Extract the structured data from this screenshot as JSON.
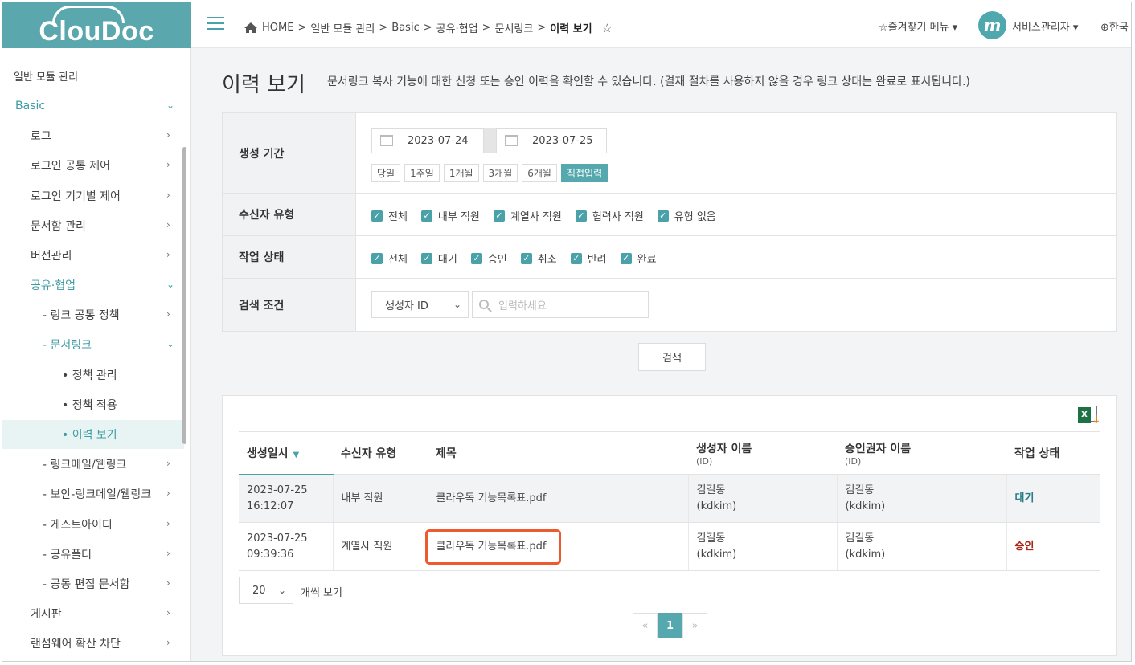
{
  "app": {
    "logo": "ClouDoc"
  },
  "sidebar": {
    "items": [
      {
        "label": "일반 모듈 관리",
        "arrow": ""
      },
      {
        "label": "Basic",
        "arrow": "⌄"
      },
      {
        "label": "로그",
        "arrow": "›"
      },
      {
        "label": "로그인 공통 제어",
        "arrow": "›"
      },
      {
        "label": "로그인 기기별 제어",
        "arrow": "›"
      },
      {
        "label": "문서함 관리",
        "arrow": "›"
      },
      {
        "label": "버전관리",
        "arrow": "›"
      },
      {
        "label": "공유·협업",
        "arrow": "⌄"
      },
      {
        "label": "- 링크 공통 정책",
        "arrow": "›"
      },
      {
        "label": "- 문서링크",
        "arrow": "⌄"
      },
      {
        "label": "• 정책 관리",
        "arrow": ""
      },
      {
        "label": "• 정책 적용",
        "arrow": ""
      },
      {
        "label": "• 이력 보기",
        "arrow": ""
      },
      {
        "label": "- 링크메일/웹링크",
        "arrow": "›"
      },
      {
        "label": "- 보안-링크메일/웹링크",
        "arrow": "›"
      },
      {
        "label": "- 게스트아이디",
        "arrow": "›"
      },
      {
        "label": "- 공유폴더",
        "arrow": "›"
      },
      {
        "label": "- 공동 편집 문서함",
        "arrow": "›"
      },
      {
        "label": "게시판",
        "arrow": "›"
      },
      {
        "label": "랜섬웨어 확산 차단",
        "arrow": "›"
      }
    ]
  },
  "topbar": {
    "breadcrumb": [
      "HOME",
      "일반 모듈 관리",
      "Basic",
      "공유·협업",
      "문서링크",
      "이력 보기"
    ],
    "favorites": "즐겨찾기 메뉴 ▾",
    "avatar_letter": "m",
    "user": "서비스관리자 ▾",
    "lang": "한국"
  },
  "page": {
    "title": "이력 보기",
    "description": "문서링크 복사 기능에 대한 신청 또는 승인 이력을 확인할 수 있습니다. (결재 절차를 사용하지 않을 경우 링크 상태는 완료로 표시됩니다.)"
  },
  "filter": {
    "period": {
      "label": "생성 기간",
      "start": "2023-07-24",
      "end": "2023-07-25",
      "dash": "-",
      "quick": [
        "당일",
        "1주일",
        "1개월",
        "3개월",
        "6개월",
        "직접입력"
      ]
    },
    "recipient": {
      "label": "수신자 유형",
      "options": [
        "전체",
        "내부 직원",
        "계열사 직원",
        "협력사 직원",
        "유형 없음"
      ]
    },
    "status": {
      "label": "작업 상태",
      "options": [
        "전체",
        "대기",
        "승인",
        "취소",
        "반려",
        "완료"
      ]
    },
    "condition": {
      "label": "검색 조건",
      "field": "생성자 ID",
      "placeholder": "입력하세요"
    },
    "search_button": "검색"
  },
  "table": {
    "headers": {
      "created": "생성일시",
      "recipient": "수신자 유형",
      "title": "제목",
      "creator": "생성자 이름",
      "creator_sub": "(ID)",
      "approver": "승인권자 이름",
      "approver_sub": "(ID)",
      "status": "작업 상태"
    },
    "rows": [
      {
        "date": "2023-07-25",
        "time": "16:12:07",
        "recipient": "내부 직원",
        "title": "클라우독 기능목록표.pdf",
        "creator": "김길동",
        "creator_id": "(kdkim)",
        "approver": "김길동",
        "approver_id": "(kdkim)",
        "status": "대기"
      },
      {
        "date": "2023-07-25",
        "time": "09:39:36",
        "recipient": "계열사 직원",
        "title": "클라우독 기능목록표.pdf",
        "creator": "김길동",
        "creator_id": "(kdkim)",
        "approver": "김길동",
        "approver_id": "(kdkim)",
        "status": "승인"
      }
    ],
    "per_page": "20",
    "per_page_label": "개씩 보기",
    "pager": {
      "prev": "«",
      "current": "1",
      "next": "»"
    },
    "excel_icon": "excel-download-icon"
  },
  "colors": {
    "brand": "#5aa8ae",
    "accent": "#4aa1a8",
    "wait": "#2a7d86",
    "approved": "#a6261a",
    "highlight": "#ec5a2e"
  }
}
